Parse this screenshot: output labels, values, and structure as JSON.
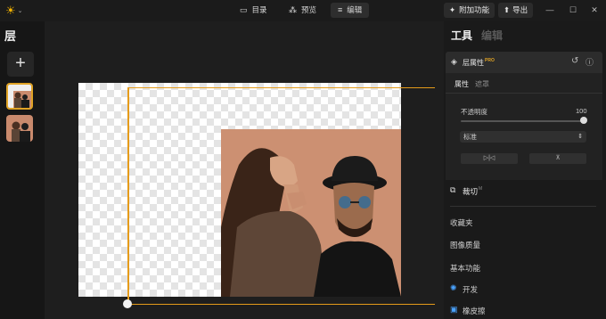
{
  "topbar": {
    "logo_icon": "sun-logo-icon",
    "nav": [
      {
        "label": "目录",
        "icon": "folder-icon"
      },
      {
        "label": "预览",
        "icon": "magic-wand-icon"
      },
      {
        "label": "编辑",
        "icon": "sliders-icon"
      }
    ],
    "addon_label": "附加功能",
    "export_label": "导出"
  },
  "left": {
    "title": "层",
    "add_label": "+"
  },
  "right": {
    "tab_tools": "工具",
    "tab_edit": "编辑",
    "layer_props": {
      "title": "层属性",
      "pro_badge": "PRO",
      "subtab_props": "属性",
      "subtab_mask": "遮罩",
      "opacity_label": "不透明度",
      "opacity_value": "100",
      "blend_mode": "标准",
      "flip_h_label": "▷|◁",
      "flip_v_label": "⊼"
    },
    "crop_label": "裁切",
    "crop_badge": "M",
    "favorites": "收藏夹",
    "image_layer": "图像质量",
    "basic": "基本功能",
    "develop": "开发",
    "eraser": "橡皮擦"
  },
  "colors": {
    "accent": "#e59b1a",
    "brand": "#f5b400",
    "develop_icon": "#4aa3ff",
    "eraser_icon": "#4aa3ff"
  }
}
